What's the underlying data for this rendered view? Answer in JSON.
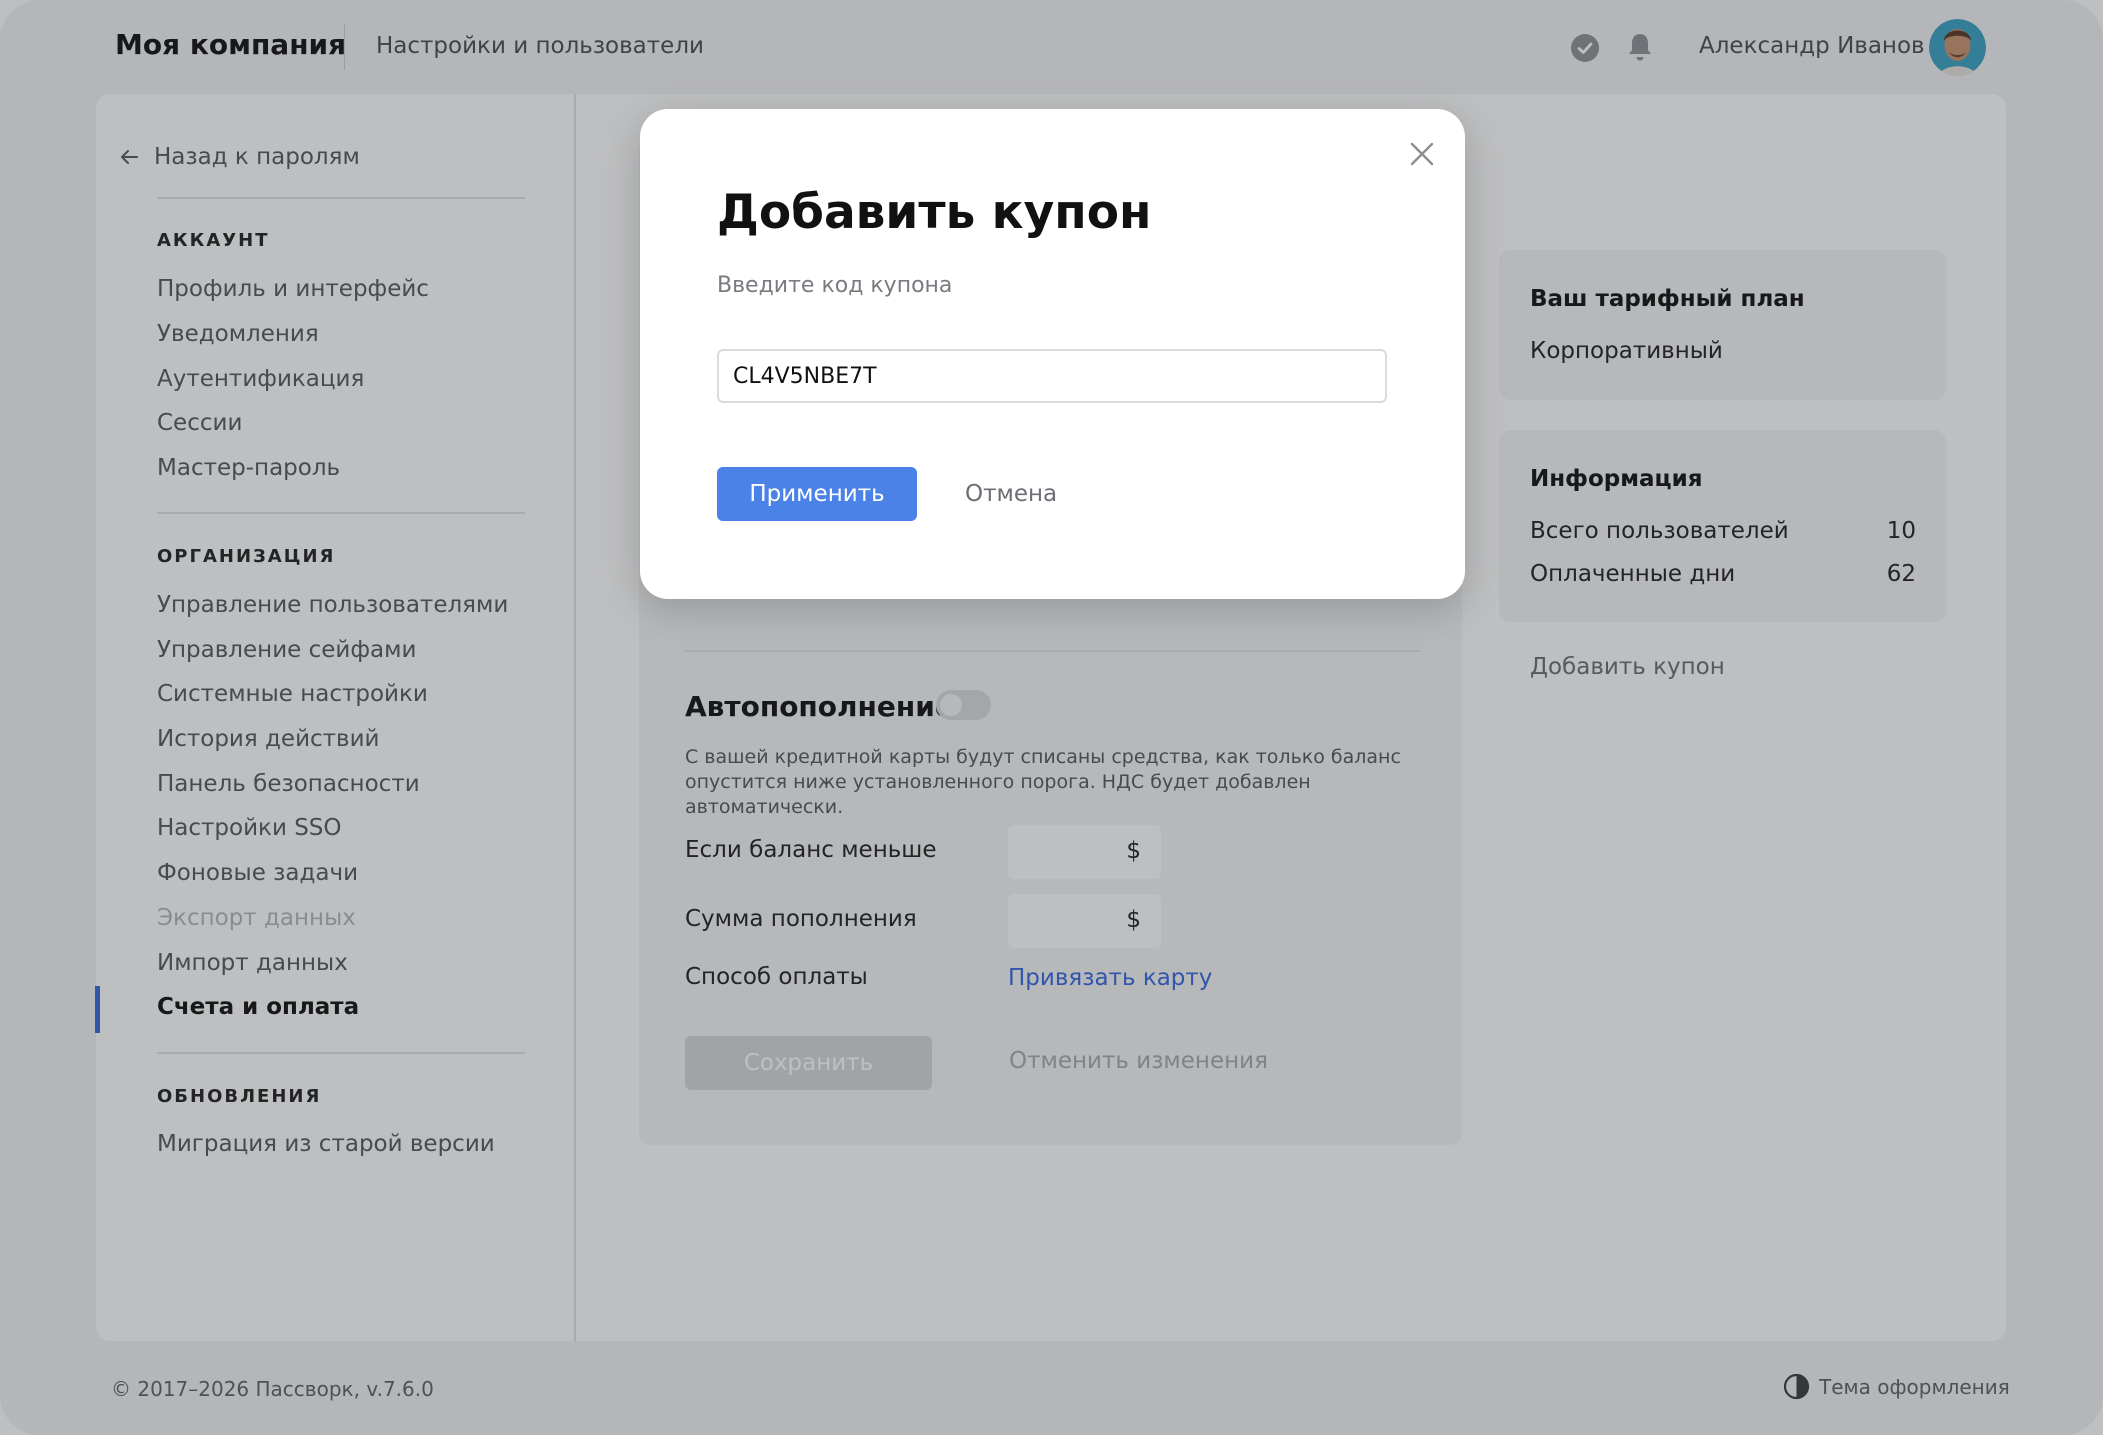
{
  "header": {
    "company": "Моя компания",
    "title": "Настройки и пользователи",
    "user_name": "Александр Иванов"
  },
  "sidebar": {
    "back_link": "Назад к паролям",
    "sections": [
      {
        "heading": "АККАУНТ",
        "items": [
          "Профиль и интерфейс",
          "Уведомления",
          "Аутентификация",
          "Сессии",
          "Мастер-пароль"
        ]
      },
      {
        "heading": "ОРГАНИЗАЦИЯ",
        "items": [
          "Управление пользователями",
          "Управление сейфами",
          "Системные настройки",
          "История действий",
          "Панель безопасности",
          "Настройки SSO",
          "Фоновые задачи",
          "Экспорт данных",
          "Импорт данных",
          "Счета и оплата"
        ]
      },
      {
        "heading": "ОБНОВЛЕНИЯ",
        "items": [
          "Миграция из старой версии"
        ]
      }
    ],
    "active_item": "Счета и оплата",
    "disabled_item": "Экспорт данных"
  },
  "billing": {
    "autofill_title": "Автопополнение",
    "autofill_enabled": false,
    "autofill_desc": "С вашей кредитной карты будут списаны средства, как только баланс опустится ниже установленного порога. НДС будет добавлен автоматически.",
    "threshold_label": "Если баланс меньше",
    "threshold_currency": "$",
    "amount_label": "Сумма пополнения",
    "amount_currency": "$",
    "payment_label": "Способ оплаты",
    "payment_link": "Привязать карту",
    "save_button": "Сохранить",
    "discard_link": "Отменить изменения"
  },
  "plan": {
    "title": "Ваш тарифный план",
    "name": "Корпоративный"
  },
  "info": {
    "title": "Информация",
    "rows": [
      {
        "label": "Всего пользователей",
        "value": "10"
      },
      {
        "label": "Оплаченные дни",
        "value": "62"
      }
    ]
  },
  "add_coupon_link": "Добавить купон",
  "footer": {
    "copyright": "© 2017–2026 Пассворк, v.7.6.0",
    "theme": "Тема оформления"
  },
  "modal": {
    "title": "Добавить купон",
    "subtitle": "Введите код купона",
    "coupon_value": "CL4V5NBE7T",
    "apply_button": "Применить",
    "cancel_button": "Отмена"
  },
  "colors": {
    "accent": "#4a82e8",
    "link": "#3567e0",
    "active_bar": "#3567e0",
    "background": "#f2f3f5"
  },
  "icons": [
    "arrow-left-icon",
    "check-circle-icon",
    "bell-icon",
    "avatar",
    "close-icon",
    "contrast-icon"
  ]
}
